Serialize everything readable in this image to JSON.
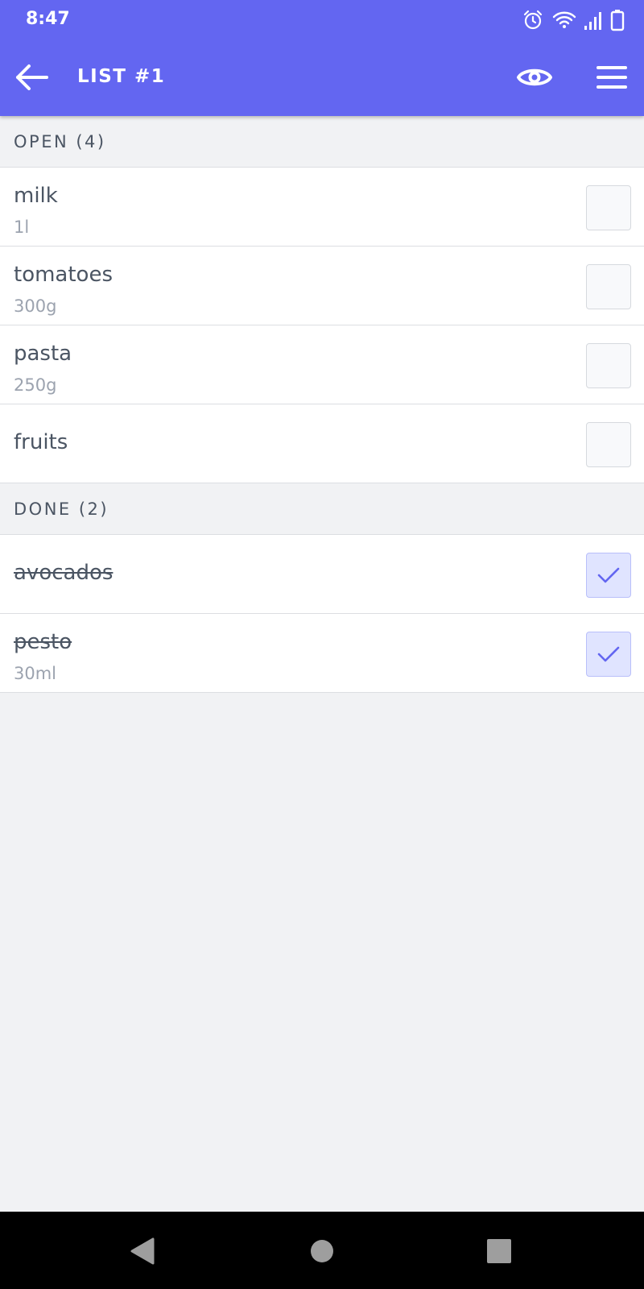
{
  "status_bar": {
    "time": "8:47",
    "icons": [
      "alarm-icon",
      "wifi-icon",
      "signal-icon",
      "battery-icon"
    ]
  },
  "toolbar": {
    "title": "LIST #1",
    "back_icon": "arrow-left-icon",
    "visibility_icon": "eye-icon",
    "menu_icon": "hamburger-menu-icon"
  },
  "colors": {
    "primary": "#6366f1",
    "background": "#f1f2f4",
    "checkbox_checked_bg": "#e0e4ff",
    "check_mark": "#6366f1"
  },
  "sections": {
    "open": {
      "header": "OPEN (4)",
      "items": [
        {
          "name": "milk",
          "quantity": "1l",
          "checked": false
        },
        {
          "name": "tomatoes",
          "quantity": "300g",
          "checked": false
        },
        {
          "name": "pasta",
          "quantity": "250g",
          "checked": false
        },
        {
          "name": "fruits",
          "quantity": "",
          "checked": false
        }
      ]
    },
    "done": {
      "header": "DONE (2)",
      "items": [
        {
          "name": "avocados",
          "quantity": "",
          "checked": true
        },
        {
          "name": "pesto",
          "quantity": "30ml",
          "checked": true
        }
      ]
    }
  },
  "nav_bar": {
    "buttons": [
      "back-triangle-icon",
      "home-circle-icon",
      "recents-square-icon"
    ]
  }
}
